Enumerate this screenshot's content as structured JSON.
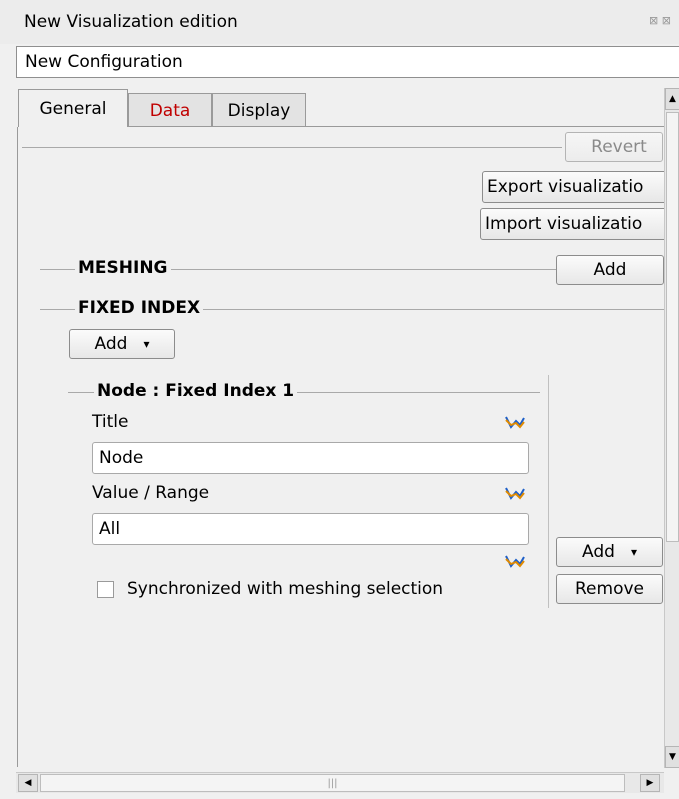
{
  "window": {
    "title": "New Visualization edition",
    "title_icons": "⊠ ⊠",
    "config_name": "New Configuration"
  },
  "tabs": [
    {
      "label": "General",
      "active": true,
      "color": "#000000"
    },
    {
      "label": "Data",
      "active": false,
      "color": "#c00000"
    },
    {
      "label": "Display",
      "active": false,
      "color": "#000000"
    }
  ],
  "general": {
    "revert_label": "Revert",
    "export_label": "Export visualizatio",
    "import_label": "Import visualizatio",
    "meshing_label": "MESHING",
    "meshing_add_label": "Add",
    "fixed_index_label": "FIXED INDEX",
    "fixed_add_label": "Add"
  },
  "node_panel": {
    "header": "Node : Fixed Index 1",
    "title_label": "Title",
    "title_value": "Node",
    "range_label": "Value / Range",
    "range_value": "All",
    "sync_label": "Synchronized with meshing selection",
    "sync_checked": false,
    "add_label": "Add",
    "remove_label": "Remove"
  },
  "icons": {
    "chart": "chart-line-icon",
    "scroll_up": "▲",
    "scroll_down": "▼",
    "scroll_left": "◀",
    "scroll_right": "▶",
    "grip": "|||"
  }
}
